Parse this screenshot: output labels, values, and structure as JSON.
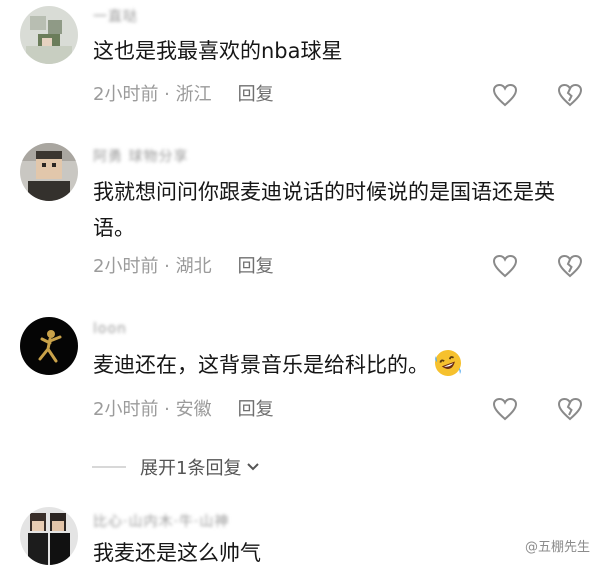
{
  "comments": [
    {
      "username": "一直哒",
      "text": "这也是我最喜欢的nba球星",
      "time_location": "2小时前 · 浙江",
      "reply_label": "回复"
    },
    {
      "username": "阿勇 球物分享",
      "text": "我就想问问你跟麦迪说话的时候说的是国语还是英语。",
      "time_location": "2小时前 · 湖北",
      "reply_label": "回复"
    },
    {
      "username": "loon",
      "text": "麦迪还在，这背景音乐是给科比的。",
      "time_location": "2小时前 · 安徽",
      "reply_label": "回复",
      "emoji": "rofl-emoji"
    },
    {
      "username": "比心·山内木·牛·山神",
      "text": "我麦还是这么帅气"
    }
  ],
  "expand_replies_label": "展开1条回复",
  "watermark": "@五棚先生",
  "colors": {
    "meta_gray": "#9b9b9b",
    "reply_gray": "#6f6f6f",
    "emoji_yellow": "#f6c12e"
  }
}
